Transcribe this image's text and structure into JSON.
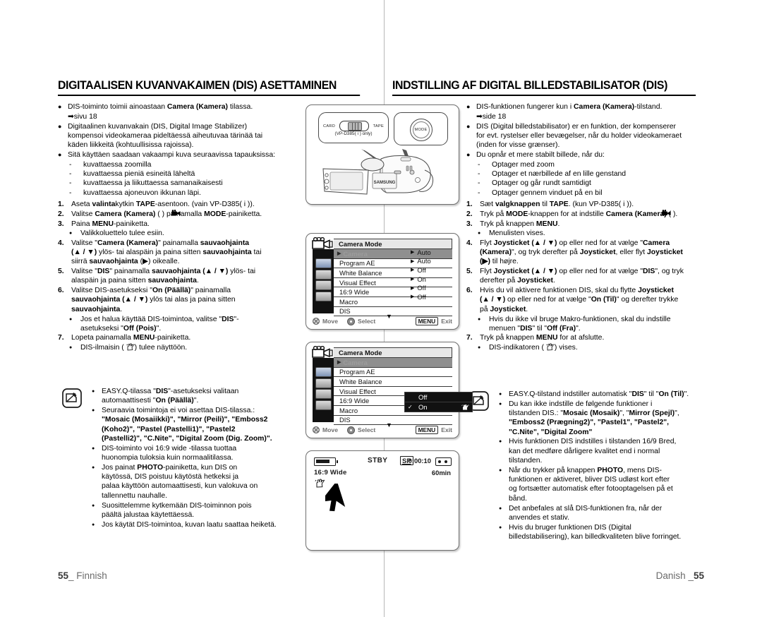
{
  "page": {
    "footer_left_number": "55",
    "footer_left_lang": "Finnish",
    "footer_right_lang": "Danish",
    "footer_right_number": "55"
  },
  "finnish": {
    "title": "DIGITAALISEN KUVANVAKAIMEN (DIS) ASETTAMINEN",
    "intro": [
      {
        "text": "DIS-toiminto toimii ainoastaan ",
        "bold": "Camera (Kamera)",
        "after": " tilassa."
      },
      {
        "ref": "sivu 18"
      }
    ],
    "b2_line1": "Digitaalinen kuvanvakain (DIS, Digital Image Stabilizer)",
    "b2_line2": "kompensoi videokameraa pideltäessä aiheutuvaa tärinää tai",
    "b2_line3": "käden liikkeitä (kohtuullisissa rajoissa).",
    "b3": "Sitä käyttäen saadaan vakaampi kuva seuraavissa tapauksissa:",
    "dashes": [
      "kuvattaessa zoomilla",
      "kuvattaessa pieniä esineitä läheltä",
      "kuvattaessa ja liikuttaessa samanaikaisesti",
      "kuvattaessa ajoneuvon ikkunan läpi."
    ],
    "steps": [
      {
        "n": "1.",
        "p1": "Aseta ",
        "b1": "valinta",
        "p2": "kytkin ",
        "b2": "TAPE",
        "p3": "-asentoon. (vain VP-D385( i ))."
      },
      {
        "n": "2.",
        "p1": "Valitse ",
        "b1": "Camera (Kamera)",
        "p2": " (  ) painamalla ",
        "b2": "MODE",
        "p3": "-painiketta."
      },
      {
        "n": "3.",
        "p1": "Paina ",
        "b1": "MENU",
        "p2": "-painiketta.",
        "sub": "Valikkoluettelo tulee esiin."
      },
      {
        "n": "4.",
        "l1a": "Valitse \"",
        "l1b": "Camera (Kamera)",
        "l1c": "\" painamalla ",
        "l1d": "sauvaohjainta",
        "l2a": "(▲ / ▼)",
        "l2b": " ylös- tai alaspäin ja paina sitten ",
        "l2c": "sauvaohjainta",
        "l2d": " tai",
        "l3a": "siirrä ",
        "l3b": "sauvaohjainta",
        "l3c": " (▶) oikealle."
      },
      {
        "n": "5.",
        "l1a": "Valitse \"",
        "l1b": "DIS",
        "l1c": "\" painamalla ",
        "l1d": "sauvaohjainta (▲ / ▼)",
        "l1e": " ylös- tai",
        "l2a": "alaspäin ja paina sitten ",
        "l2b": "sauvaohjainta",
        "l2c": "."
      },
      {
        "n": "6.",
        "l1a": "Valitse DIS-asetukseksi \"",
        "l1b": "On (Päällä)",
        "l1c": "\" painamalla",
        "l2a": "sauvaohjainta (▲ / ▼)",
        "l2b": " ylös tai alas ja paina sitten",
        "l3a": "sauvaohjainta",
        "l3b": ".",
        "sub1a": "Jos et halua käyttää DIS-toimintoa, valitse \"",
        "sub1b": "DIS",
        "sub1c": "\"-",
        "sub2a": "asetukseksi \"",
        "sub2b": "Off (Pois)",
        "sub2c": "\"."
      },
      {
        "n": "7.",
        "p1": "Lopeta painamalla ",
        "b1": "MENU",
        "p2": "-painiketta.",
        "sub_pre": "DIS-ilmaisin (",
        "sub_post": ") tulee näyttöön."
      }
    ],
    "notes": [
      {
        "l1a": "EASY.Q-tilassa \"",
        "l1b": "DIS",
        "l1c": "\"-asetukseksi valitaan",
        "l2a": "automaattisesti \"",
        "l2b": "On (Päällä)",
        "l2c": "\"."
      },
      {
        "l1": "Seuraavia toimintoja ei voi asettaa DIS-tilassa.:",
        "l2": "\"Mosaic (Mosaiikki)\", \"Mirror (Peili)\", \"Emboss2",
        "l3": "(Koho2)\", \"Pastel (Pastelli1)\", \"Pastel2",
        "l4": "(Pastelli2)\", \"C.Nite\", \"Digital Zoom (Dig. Zoom)\"."
      },
      {
        "l1": "DIS-toiminto voi 16:9 wide -tilassa tuottaa",
        "l2": "huonompia tuloksia kuin normaalitilassa."
      },
      {
        "l1a": "Jos painat ",
        "l1b": "PHOTO",
        "l1c": "-painiketta, kun DIS on",
        "l2": "käytössä, DIS poistuu käytöstä hetkeksi ja",
        "l3": "palaa käyttöön automaattisesti, kun valokuva on",
        "l4": "tallennettu nauhalle."
      },
      {
        "l1": "Suosittelemme kytkemään DIS-toiminnon pois",
        "l2": "päältä jalustaa käytettäessä."
      },
      {
        "l1": "Jos käytät DIS-toimintoa, kuvan laatu saattaa heiketä."
      }
    ]
  },
  "danish": {
    "title": "INDSTILLING AF DIGITAL BILLEDSTABILISATOR (DIS)",
    "intro_b1a": "DIS-funktionen fungerer kun i ",
    "intro_b1b": "Camera (Kamera)",
    "intro_b1c": "-tilstand.",
    "ref": "side 18",
    "b2_line1": "DIS (Digital billedstabilisator) er en funktion, der kompenserer",
    "b2_line2": "for evt. rystelser eller bevægelser, når du holder videokameraet",
    "b2_line3": "(inden for visse grænser).",
    "b3": "Du opnår et mere stabilt billede, når du:",
    "dashes": [
      "Optager med zoom",
      "Optager et nærbillede af en lille genstand",
      "Optager og går rundt samtidigt",
      "Optager gennem vinduet på en bil"
    ],
    "steps": [
      {
        "n": "1.",
        "p1": "Sæt ",
        "b1": "valgknappen",
        "p2": " til ",
        "b2": "TAPE",
        "p3": ". (kun VP-D385( i ))."
      },
      {
        "n": "2.",
        "p1": "Tryk på ",
        "b1": "MODE",
        "p2": "-knappen for at indstille ",
        "b2": "Camera (Kamera)",
        "p3": " (  )."
      },
      {
        "n": "3.",
        "p1": "Tryk på knappen ",
        "b1": "MENU",
        "p2": ".",
        "sub": "Menulisten vises."
      },
      {
        "n": "4.",
        "l1a": "Flyt ",
        "l1b": "Joysticket (▲ / ▼)",
        "l1c": " op eller ned for at vælge \"",
        "l1d": "Camera",
        "l2a": "(Kamera)",
        "l2b": "\", og tryk derefter på ",
        "l2c": "Joysticket",
        "l2d": ", eller flyt ",
        "l2e": "Joysticket",
        "l3a": "(▶)",
        "l3b": " til højre."
      },
      {
        "n": "5.",
        "l1a": "Flyt ",
        "l1b": "Joysticket (▲ / ▼)",
        "l1c": " op eller ned for at vælge \"",
        "l1d": "DIS",
        "l1e": "\", og tryk",
        "l2a": "derefter på ",
        "l2b": "Joysticket",
        "l2c": "."
      },
      {
        "n": "6.",
        "l1a": "Hvis du vil aktivere funktionen DIS, skal du flytte ",
        "l1b": "Joysticket",
        "l2a": "(▲ / ▼)",
        "l2b": " op eller ned for at vælge \"",
        "l2c": "On (Til)",
        "l2d": "\" og derefter trykke",
        "l3a": "på ",
        "l3b": "Joysticket",
        "l3c": ".",
        "sub1": "Hvis du ikke vil bruge Makro-funktionen, skal du indstille",
        "sub2a": "menuen \"",
        "sub2b": "DIS",
        "sub2c": "\" til \"",
        "sub2d": "Off (Fra)",
        "sub2e": "\"."
      },
      {
        "n": "7.",
        "p1": "Tryk på knappen ",
        "b1": "MENU",
        "p2": " for at afslutte.",
        "sub_pre": "DIS-indikatoren (",
        "sub_post": ") vises."
      }
    ],
    "notes": [
      {
        "l1a": "EASY.Q-tilstand indstiller automatisk \"",
        "l1b": "DIS",
        "l1c": "\" til \"",
        "l1d": "On (Til)",
        "l1e": "\"."
      },
      {
        "l1": "Du kan ikke indstille de følgende funktioner i",
        "l2a": "tilstanden DIS.: \"",
        "l2b": "Mosaic (Mosaik)",
        "l2c": "\", \"",
        "l2d": "Mirror (Spejl)",
        "l2e": "\",",
        "l3": "\"Emboss2 (Prægning2)\", \"Pastel1\", \"Pastel2\",",
        "l4": "\"C.Nite\", \"Digital Zoom\""
      },
      {
        "l1": "Hvis funktionen DIS indstilles i tilstanden 16/9 Bred,",
        "l2": "kan det medføre dårligere kvalitet end i normal",
        "l3": "tilstanden."
      },
      {
        "l1a": "Når du trykker på knappen ",
        "l1b": "PHOTO",
        "l1c": ", mens DIS-",
        "l2": "funktionen er aktiveret, bliver DIS udløst kort efter",
        "l3": "og fortsætter automatisk efter fotooptagelsen på et",
        "l4": "bånd."
      },
      {
        "l1": "Det anbefales at slå DIS-funktionen fra, når der",
        "l2": "anvendes et stativ."
      },
      {
        "l1": "Hvis du bruger funktionen DIS (Digital",
        "l2": "billedstabilisering), kan billedkvaliteten blive forringet."
      }
    ]
  },
  "figures": {
    "camera": {
      "switch_left_label": "CARD",
      "switch_right_label": "TAPE",
      "switch_note": "(VP-D385( i ) only)",
      "mode_label": "MODE"
    },
    "menu1": {
      "title": "Camera Mode",
      "highlight": "Camera",
      "items": [
        {
          "label": "Program AE",
          "value": "Auto"
        },
        {
          "label": "White Balance",
          "value": "Auto"
        },
        {
          "label": "Visual Effect",
          "value": "Off"
        },
        {
          "label": "16:9 Wide",
          "value": "On"
        },
        {
          "label": "Macro",
          "value": "Off"
        },
        {
          "label": "DIS",
          "value": "Off"
        }
      ],
      "move_label": "Move",
      "select_label": "Select",
      "menu_key": "MENU",
      "exit_label": "Exit"
    },
    "menu2": {
      "title": "Camera Mode",
      "highlight": "Camera",
      "items": [
        {
          "label": "Program AE"
        },
        {
          "label": "White Balance"
        },
        {
          "label": "Visual Effect"
        },
        {
          "label": "16:9 Wide"
        },
        {
          "label": "Macro"
        },
        {
          "label": "DIS"
        }
      ],
      "submenu": [
        {
          "label": "Off",
          "checked": false
        },
        {
          "label": "On",
          "checked": true
        }
      ],
      "move_label": "Move",
      "select_label": "Select",
      "menu_key": "MENU",
      "exit_label": "Exit"
    },
    "lcd": {
      "status": "STBY",
      "quality": "SP",
      "timecode": "0:00:10",
      "wide": "16:9 Wide",
      "remaining": "60min"
    }
  }
}
